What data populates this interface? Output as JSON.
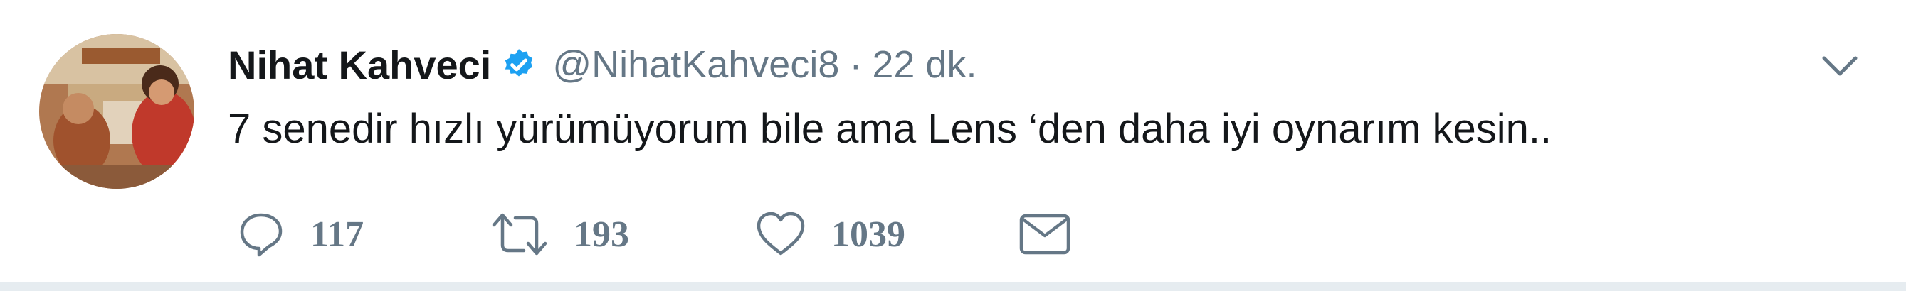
{
  "user": {
    "name": "Nihat Kahveci",
    "handle": "@NihatKahveci8",
    "separator": "·",
    "time": "22 dk.",
    "verified": true,
    "verified_color": "#1da1f2"
  },
  "tweet": {
    "text": "7 senedir hızlı yürümüyorum bile ama Lens ‘den daha iyi oynarım kesin.."
  },
  "actions": {
    "reply": {
      "icon": "reply-icon",
      "count": "117"
    },
    "retweet": {
      "icon": "retweet-icon",
      "count": "193"
    },
    "like": {
      "icon": "heart-icon",
      "count": "1039"
    },
    "message": {
      "icon": "envelope-icon"
    }
  },
  "menu": {
    "icon": "chevron-down-icon"
  },
  "colors": {
    "text": "#14171a",
    "secondary": "#657786",
    "icon": "#657786"
  }
}
